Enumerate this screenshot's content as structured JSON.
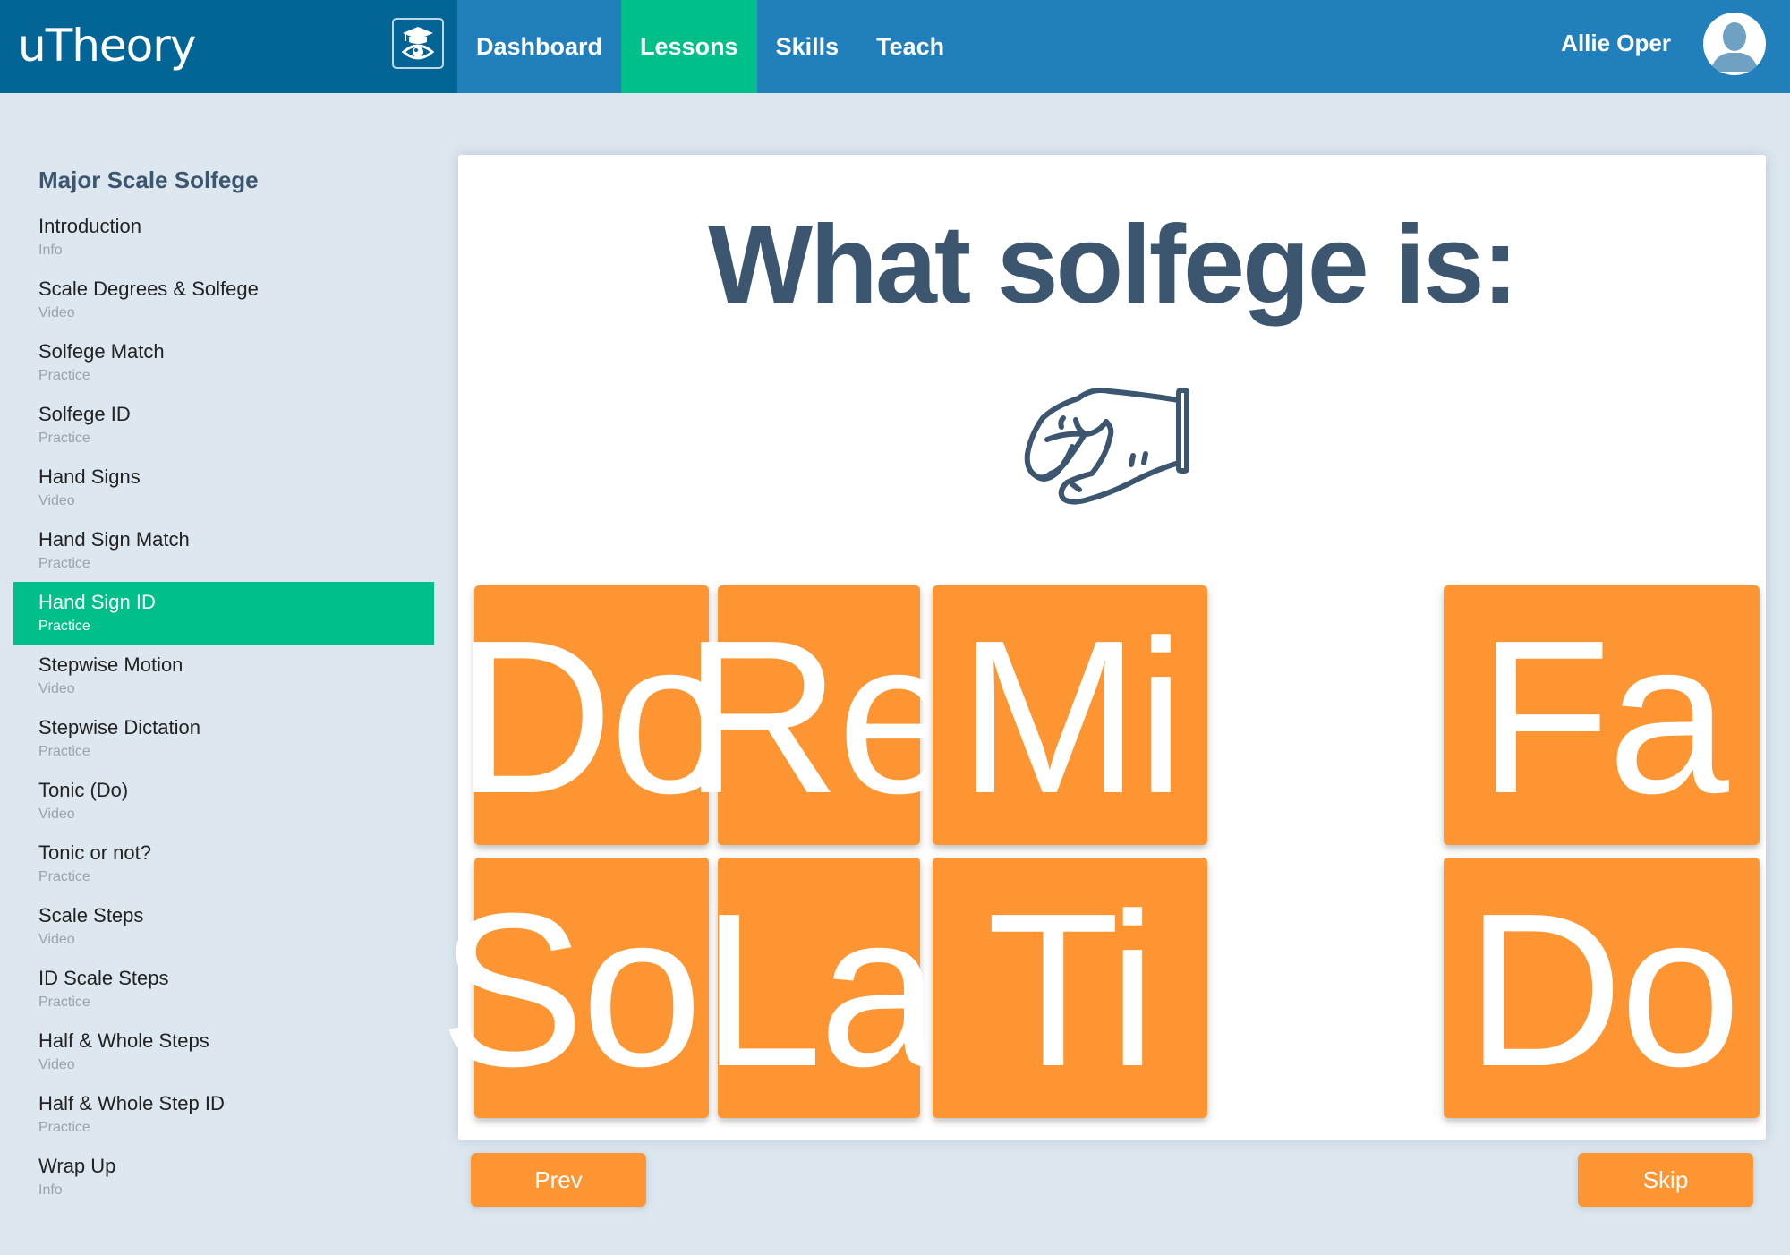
{
  "app": {
    "logo_text": "uTheory",
    "logo_icon": "graduation-cap-eye-icon"
  },
  "nav": {
    "items": [
      {
        "label": "Dashboard",
        "active": false
      },
      {
        "label": "Lessons",
        "active": true
      },
      {
        "label": "Skills",
        "active": false
      },
      {
        "label": "Teach",
        "active": false
      }
    ]
  },
  "user": {
    "name": "Allie Oper",
    "avatar_icon": "user-silhouette-icon"
  },
  "sidebar": {
    "heading": "Major Scale Solfege",
    "items": [
      {
        "title": "Introduction",
        "kind": "Info"
      },
      {
        "title": "Scale Degrees & Solfege",
        "kind": "Video"
      },
      {
        "title": "Solfege Match",
        "kind": "Practice"
      },
      {
        "title": "Solfege ID",
        "kind": "Practice"
      },
      {
        "title": "Hand Signs",
        "kind": "Video"
      },
      {
        "title": "Hand Sign Match",
        "kind": "Practice"
      },
      {
        "title": "Hand Sign ID",
        "kind": "Practice",
        "active": true
      },
      {
        "title": "Stepwise Motion",
        "kind": "Video"
      },
      {
        "title": "Stepwise Dictation",
        "kind": "Practice"
      },
      {
        "title": "Tonic (Do)",
        "kind": "Video"
      },
      {
        "title": "Tonic or not?",
        "kind": "Practice"
      },
      {
        "title": "Scale Steps",
        "kind": "Video"
      },
      {
        "title": "ID Scale Steps",
        "kind": "Practice"
      },
      {
        "title": "Half & Whole Steps",
        "kind": "Video"
      },
      {
        "title": "Half & Whole Step ID",
        "kind": "Practice"
      },
      {
        "title": "Wrap Up",
        "kind": "Info"
      }
    ]
  },
  "question": {
    "prompt": "What solfege is:",
    "image_icon": "hand-sign-icon",
    "answers": [
      "Do",
      "Re",
      "Mi",
      "Fa",
      "Sol",
      "La",
      "Ti",
      "Do"
    ]
  },
  "buttons": {
    "prev": "Prev",
    "skip": "Skip"
  },
  "colors": {
    "header_dark": "#036496",
    "header": "#2180bb",
    "accent_green": "#00bf88",
    "answer_orange": "#fe9533",
    "title_navy": "#3d5670",
    "background": "#dde7ef"
  }
}
